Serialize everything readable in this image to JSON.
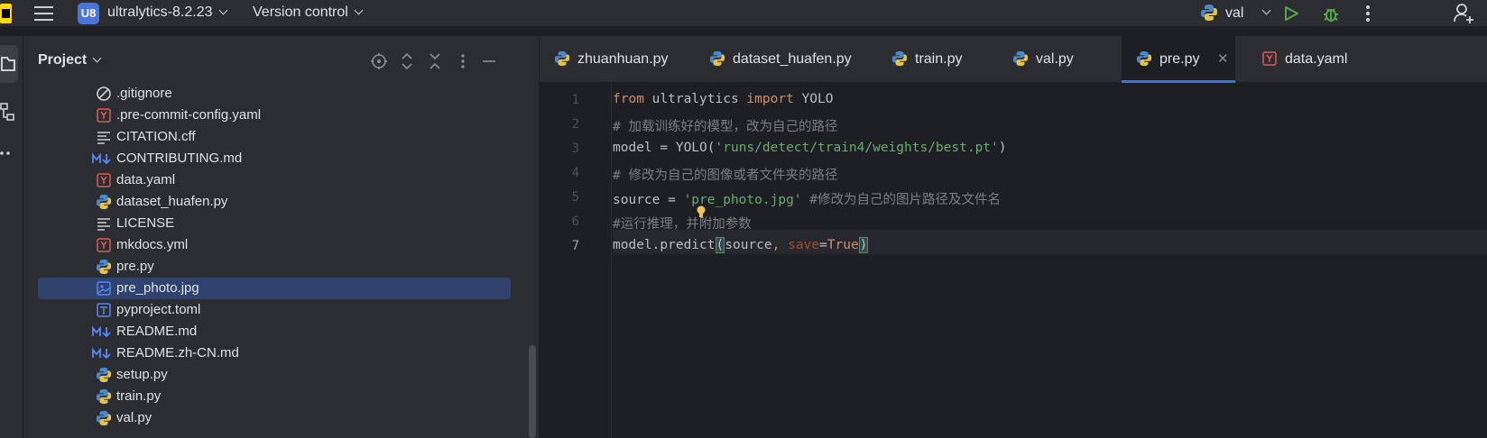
{
  "topbar": {
    "project_badge": "U8",
    "project_name": "ultralytics-8.2.23",
    "vcs_label": "Version control",
    "run_config": "val"
  },
  "project_panel": {
    "title": "Project",
    "files": [
      {
        "name": ".gitignore",
        "icon": "ignore-file-icon"
      },
      {
        "name": ".pre-commit-config.yaml",
        "icon": "yaml-file-icon"
      },
      {
        "name": "CITATION.cff",
        "icon": "text-file-icon"
      },
      {
        "name": "CONTRIBUTING.md",
        "icon": "markdown-file-icon"
      },
      {
        "name": "data.yaml",
        "icon": "yaml-file-icon"
      },
      {
        "name": "dataset_huafen.py",
        "icon": "python-file-icon"
      },
      {
        "name": "LICENSE",
        "icon": "text-file-icon"
      },
      {
        "name": "mkdocs.yml",
        "icon": "yaml-file-icon"
      },
      {
        "name": "pre.py",
        "icon": "python-file-icon"
      },
      {
        "name": "pre_photo.jpg",
        "icon": "image-file-icon",
        "selected": true
      },
      {
        "name": "pyproject.toml",
        "icon": "toml-file-icon"
      },
      {
        "name": "README.md",
        "icon": "markdown-file-icon"
      },
      {
        "name": "README.zh-CN.md",
        "icon": "markdown-file-icon"
      },
      {
        "name": "setup.py",
        "icon": "python-file-icon"
      },
      {
        "name": "train.py",
        "icon": "python-file-icon"
      },
      {
        "name": "val.py",
        "icon": "python-file-icon"
      }
    ]
  },
  "editor": {
    "tabs": [
      {
        "label": "zhuanhuan.py",
        "icon": "python-file-icon"
      },
      {
        "label": "dataset_huafen.py",
        "icon": "python-file-icon"
      },
      {
        "label": "train.py",
        "icon": "python-file-icon"
      },
      {
        "label": "val.py",
        "icon": "python-file-icon"
      },
      {
        "label": "pre.py",
        "icon": "python-file-icon",
        "active": true
      },
      {
        "label": "data.yaml",
        "icon": "yaml-file-icon"
      }
    ],
    "line_numbers": [
      "1",
      "2",
      "3",
      "4",
      "5",
      "6",
      "7"
    ],
    "current_line": "7",
    "code": {
      "l1_from": "from",
      "l1_mod": " ultralytics ",
      "l1_import": "import",
      "l1_name": " YOLO",
      "l2_comment": "# 加载训练好的模型，改为自己的路径",
      "l3_pre": "model = YOLO(",
      "l3_str": "'runs/detect/train4/weights/best.pt'",
      "l3_post": ")",
      "l4_comment": "# 修改为自己的图像或者文件夹的路径",
      "l5_pre": "source = ",
      "l5_str": "'pre_photo.jpg'",
      "l5_comment": " #修改为自己的图片路径及文件名",
      "l6_hash": "#",
      "l6_comment": "运行推理，并附加参数",
      "l7_pre": "model.predict",
      "l7_open": "(",
      "l7_arg": "source",
      "l7_comma": ", ",
      "l7_kw": "save",
      "l7_eq": "=",
      "l7_true": "True",
      "l7_close": ")"
    }
  },
  "colors": {
    "keyword": "#cf8e6d",
    "string": "#6aab73",
    "comment": "#7a7e85",
    "accent": "#3574f0",
    "selection": "#2e436e"
  }
}
